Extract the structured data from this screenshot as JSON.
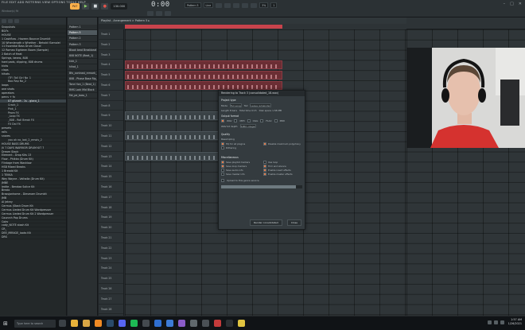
{
  "topbar": {
    "menu": "FILE  EDIT  ADD  PATTERNS  VIEW  OPTIONS  TOOLS  HELP",
    "hint": "Window(s) fit",
    "pattern_mode": "PAT",
    "song_mode": "SONG",
    "tempo": "130.000",
    "time": "0:00",
    "time_ms": "00",
    "pattern_selector": "Pattern 5",
    "snap": "Line",
    "cpu": "3%",
    "memory": "MB",
    "voices": "1",
    "accent_color": "#ffb04a"
  },
  "browser": {
    "items": [
      {
        "label": "Snapshots",
        "type": "folder"
      },
      {
        "label": "B&Fs",
        "type": "folder"
      },
      {
        "label": "HOUSE",
        "type": "folder"
      },
      {
        "label": "1 Cashflow - Hazeen Bounce Drumkit",
        "type": "folder"
      },
      {
        "label": "10 Whenlength x Whether - Behold (Sample)",
        "type": "folder"
      },
      {
        "label": "11 Essential Bass Drum Cloud",
        "type": "folder"
      },
      {
        "label": "12 Romeo Eighteen Boom (Sample)",
        "type": "folder"
      },
      {
        "label": "2 Batch of Heat",
        "type": "folder"
      },
      {
        "label": "Springs, beans, 808",
        "type": "folder"
      },
      {
        "label": "hard pads, clipping, 808 drums",
        "type": "folder"
      },
      {
        "label": "kicks",
        "type": "folder"
      },
      {
        "label": "claps",
        "type": "folder"
      },
      {
        "label": "hihats",
        "type": "folder"
      },
      {
        "label": "(TF) Tall Girl No_1",
        "type": "file"
      },
      {
        "label": "Boo Rap No_2",
        "type": "file"
      },
      {
        "label": "loops",
        "type": "folder"
      },
      {
        "label": "one shots",
        "type": "folder"
      },
      {
        "label": "operators",
        "type": "folder"
      },
      {
        "label": "percs + fx",
        "type": "folder"
      },
      {
        "label": "07 glizzoh - 1s - glaco_1",
        "type": "file",
        "selected": true
      },
      {
        "label": "Crack_1",
        "type": "file"
      },
      {
        "label": "Pink_1",
        "type": "file"
      },
      {
        "label": "Pewa FX",
        "type": "file"
      },
      {
        "label": "_Loop FX",
        "type": "file"
      },
      {
        "label": "_808 - Roll Break FX",
        "type": "file"
      },
      {
        "label": "FX Dal FX",
        "type": "file"
      },
      {
        "label": "presets",
        "type": "folder"
      },
      {
        "label": "rolls",
        "type": "folder"
      },
      {
        "label": "snares",
        "type": "folder"
      },
      {
        "label": "you ok no_lost_2_emois_2",
        "type": "file"
      },
      {
        "label": "HOUSE BASS DRUMS",
        "type": "folder"
      },
      {
        "label": "JV 7 DAYS WARRIOR DRUM KIT 7",
        "type": "folder"
      },
      {
        "label": "Dream Stack",
        "type": "folder"
      },
      {
        "label": "Element - Drop Kits 13",
        "type": "folder"
      },
      {
        "label": "Flow - Phikka (Drum Kit)",
        "type": "folder"
      },
      {
        "label": "Flintage from Washlow",
        "type": "folder"
      },
      {
        "label": "HSB Mixed Breaks",
        "type": "folder"
      },
      {
        "label": "1 Breadd Kit",
        "type": "folder"
      },
      {
        "label": "1 TEKKA",
        "type": "folder"
      },
      {
        "label": "Wey Wayne - Valhalla (Drum Kit)",
        "type": "folder"
      },
      {
        "label": "JMBE",
        "type": "folder"
      },
      {
        "label": "Jedite - Bendag Splice Kit",
        "type": "folder"
      },
      {
        "label": "Brezio",
        "type": "folder"
      },
      {
        "label": "Brassjonhome - Diesmam Drumkit",
        "type": "folder"
      },
      {
        "label": "JMB",
        "type": "folder"
      },
      {
        "label": "Al Jetrey",
        "type": "folder"
      },
      {
        "label": "Cermus (Stack Drum Kit",
        "type": "folder"
      },
      {
        "label": "Cermus Lieded Drum Kit Wordpresser",
        "type": "folder"
      },
      {
        "label": "Cermus Lieded Drum Kit 2 Wordpresser",
        "type": "folder"
      },
      {
        "label": "Counrch Pop Drums",
        "type": "folder"
      },
      {
        "label": "Coby",
        "type": "folder"
      },
      {
        "label": "cody_NOTE stash Kit",
        "type": "folder"
      },
      {
        "label": "CR_",
        "type": "folder"
      },
      {
        "label": "DEE_MIRAGE_looks Kit",
        "type": "folder"
      },
      {
        "label": "DRS",
        "type": "folder"
      }
    ]
  },
  "picker": {
    "items": [
      {
        "label": "Pattern 1"
      },
      {
        "label": "Pattern 5",
        "selected": true
      },
      {
        "label": "Pattern 2"
      },
      {
        "label": "Pattern 3"
      },
      {
        "label": "Blook beat Breakbeat"
      },
      {
        "label": "808 NOTE (Beat_1)"
      },
      {
        "label": "kick_1"
      },
      {
        "label": "hihat_1"
      },
      {
        "label": "Bfx_contrast_remark_1"
      },
      {
        "label": "808 - Phase Base Rip_1"
      },
      {
        "label": "Tone Hon_1 (Beat_1)"
      },
      {
        "label": "RMS Lock Mid Block"
      },
      {
        "label": "Fat_pe_bass_1"
      }
    ]
  },
  "playlist": {
    "title": "Playlist - Arrangement > Pattern 5 ▸",
    "tracks": [
      "Track 1",
      "Track 2",
      "Track 3",
      "Track 4",
      "Track 5",
      "Track 6",
      "Track 7",
      "Track 8",
      "Track 9",
      "Track 10",
      "Track 11",
      "Track 12",
      "Track 13",
      "Track 14",
      "Track 15",
      "Track 16",
      "Track 17",
      "Track 18",
      "Track 19",
      "Track 20",
      "Track 21",
      "Track 22",
      "Track 23",
      "Track 24",
      "Track 25",
      "Track 26",
      "Track 27",
      "Track 28"
    ],
    "loop_color": "#c8434c",
    "clip_color": "#6b2e34"
  },
  "dialog": {
    "title": "Rendering to Track 3 (consolidated_18.wav)",
    "project_type": "Project type",
    "mode_label": "Mode",
    "mode_value": "Full song",
    "tail_label": "Tail",
    "tail_value": "Leave remainder",
    "length_label": "Length 8 bars",
    "total_time": "Total time 0:15",
    "disk_space": "Disk space 1.58 MB",
    "output_format": "Output format",
    "wav": "WAV",
    "mp3": "MP3",
    "ogg": "OGG",
    "flac": "FLAC",
    "midi": "MIDI",
    "wav_bit_depth": "WAV bit depth",
    "bit_depth_value": "24Bit integer",
    "quality": "Quality",
    "resampling_label": "Resampling",
    "hq_all_plugins": "HQ for all plugins",
    "disable_max_polyphony": "Disable maximum polyphony",
    "dithering": "Dithering",
    "misc": "Miscellaneous",
    "save_playlist_markers": "Save playlist markers",
    "use_loop": "Use loop",
    "save_loop_markers": "Save loop markers",
    "trim_end": "Trim end silence",
    "save_audio_info": "Save audio info",
    "enable_insert_effects": "Enable insert effects",
    "save_master_info": "Save master info",
    "enable_master_effects": "Enable master effects",
    "upload": "Upload to this genre service",
    "render_start": "Render consolidated",
    "cancel": "Close",
    "progress": 0.92
  },
  "taskbar": {
    "search": "Type here to search",
    "time": "1:57 AM",
    "date": "1/26/2021"
  }
}
